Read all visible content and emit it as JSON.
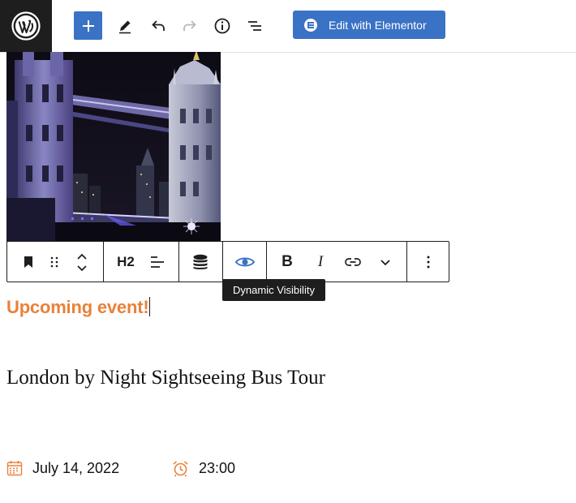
{
  "topbar": {
    "logo_icon": "wordpress-logo-icon",
    "add_icon": "plus-icon",
    "tools_icon": "pencil-icon",
    "undo_icon": "undo-icon",
    "redo_icon": "redo-icon",
    "info_icon": "info-icon",
    "list_view_icon": "list-view-icon",
    "elementor_label": "Edit with Elementor",
    "accent_color": "#3a72c5"
  },
  "block_toolbar": {
    "heading_level": "H2",
    "tooltip": "Dynamic Visibility",
    "bold_label": "B",
    "italic_label": "I"
  },
  "content": {
    "upcoming_label": "Upcoming event!",
    "upcoming_color": "#e8823a",
    "event_title": "London by Night Sightseeing Bus Tour",
    "date": "July 14, 2022",
    "time": "23:00"
  }
}
